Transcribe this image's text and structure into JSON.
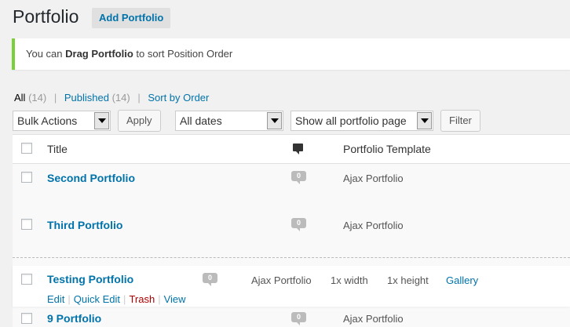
{
  "page": {
    "title": "Portfolio",
    "add_button": "Add Portfolio"
  },
  "notice": {
    "prefix": "You can ",
    "bold": "Drag Portfolio",
    "suffix": " to sort Position Order"
  },
  "filters": {
    "all_label": "All",
    "all_count": "(14)",
    "published_label": "Published",
    "published_count": "(14)",
    "sort_label": "Sort by Order"
  },
  "toolbar": {
    "bulk_actions": "Bulk Actions",
    "apply": "Apply",
    "dates": "All dates",
    "portfolio_page": "Show all portfolio page",
    "filter": "Filter"
  },
  "table": {
    "headers": {
      "title": "Title",
      "template": "Portfolio Template"
    },
    "rows": [
      {
        "title": "Second Portfolio",
        "comments": "0",
        "template": "Ajax Portfolio"
      },
      {
        "title": "Third Portfolio",
        "comments": "0",
        "template": "Ajax Portfolio"
      },
      {
        "title": "Testing Portfolio",
        "comments": "0",
        "template": "Ajax Portfolio",
        "width": "1x width",
        "height": "1x height",
        "link": "Gallery",
        "actions": {
          "edit": "Edit",
          "quick_edit": "Quick Edit",
          "trash": "Trash",
          "view": "View"
        }
      },
      {
        "title": "9 Portfolio",
        "comments": "0",
        "template": "Ajax Portfolio"
      }
    ]
  },
  "colors": {
    "accent": "#0073aa",
    "notice_border": "#7ad03a",
    "trash": "#aa0000"
  }
}
